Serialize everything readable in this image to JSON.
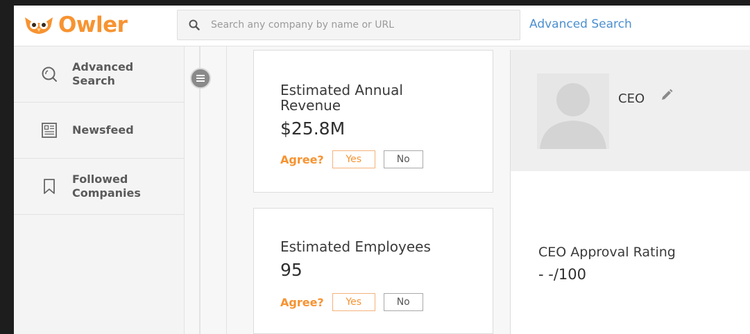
{
  "header": {
    "logo_text": "Owler",
    "search_placeholder": "Search any company by name or URL",
    "advanced_search_link": "Advanced Search"
  },
  "sidebar": {
    "items": [
      {
        "label": "Advanced Search",
        "icon": "search-icon"
      },
      {
        "label": "Newsfeed",
        "icon": "newsfeed-icon"
      },
      {
        "label": "Followed Companies",
        "icon": "bookmark-icon"
      }
    ]
  },
  "cards": {
    "revenue": {
      "title": "Estimated Annual Revenue",
      "value": "$25.8M",
      "agree_label": "Agree?",
      "yes": "Yes",
      "no": "No"
    },
    "employees": {
      "title": "Estimated Employees",
      "value": "95",
      "agree_label": "Agree?",
      "yes": "Yes",
      "no": "No"
    }
  },
  "ceo": {
    "title": "CEO",
    "approval_label": "CEO Approval Rating",
    "approval_value": "- -/100"
  },
  "colors": {
    "brand_orange": "#f79331",
    "link_blue": "#4b8fcf"
  }
}
